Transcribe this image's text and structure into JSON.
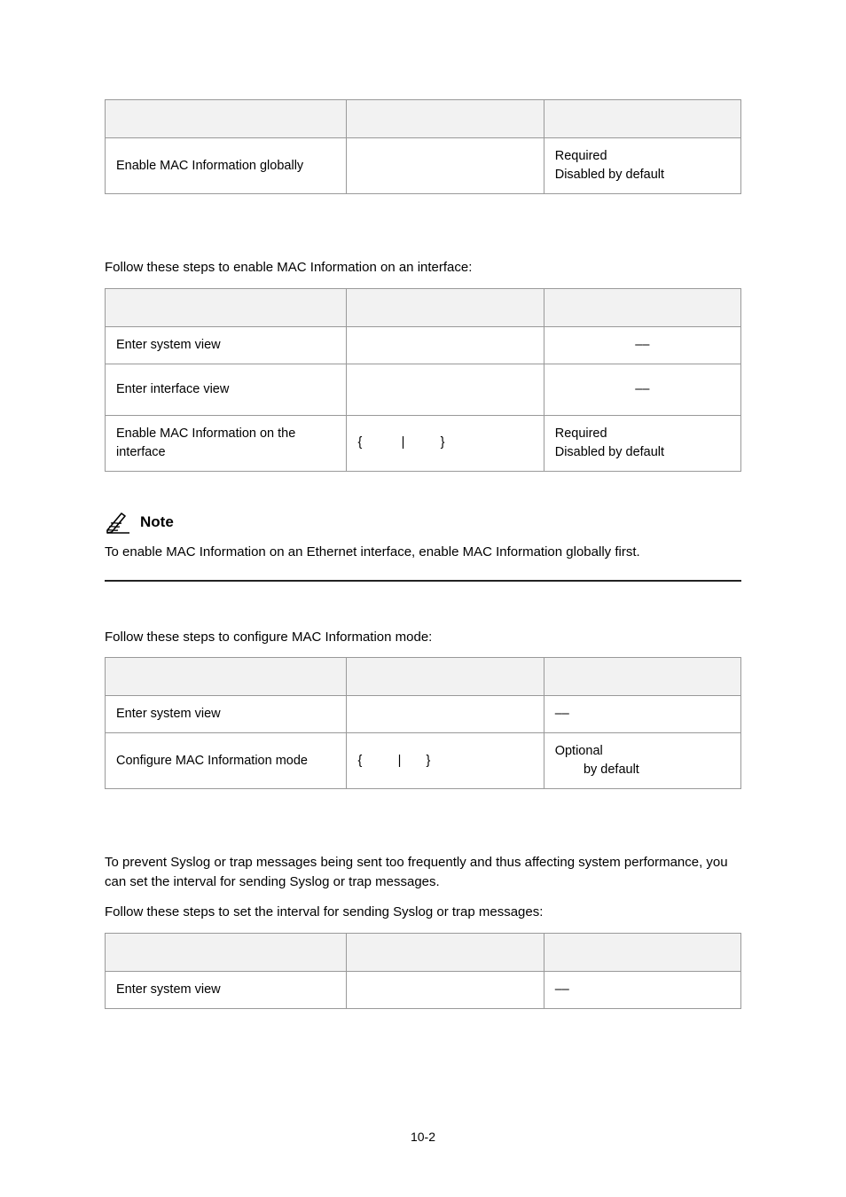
{
  "t1": {
    "r2c1": "Enable MAC Information globally",
    "r2c3a": "Required",
    "r2c3b": "Disabled by default"
  },
  "s2": {
    "lead": "Follow these steps to enable MAC Information on an interface:",
    "r1c1": "Enter system view",
    "r1c3": "––",
    "r2c1": "Enter interface view",
    "r2c3": "––",
    "r3c1": "Enable MAC Information on the interface",
    "r3c2": "{           |          }",
    "r3c3a": "Required",
    "r3c3b": "Disabled by default"
  },
  "note": {
    "label": "Note",
    "text": "To enable MAC Information on an Ethernet interface, enable MAC Information globally first."
  },
  "s3": {
    "lead": "Follow these steps to configure MAC Information mode:",
    "r1c1": "Enter system view",
    "r1c3": "––",
    "r2c1": "Configure MAC Information mode",
    "r2c2": "{          |       }",
    "r2c3a": "Optional",
    "r2c3b": "        by default"
  },
  "s4": {
    "p1": "To prevent Syslog or trap messages being sent too frequently and thus affecting system performance, you can set the interval for sending Syslog or trap messages.",
    "p2": "Follow these steps to set the interval for sending Syslog or trap messages:",
    "r1c1": "Enter system view",
    "r1c3": "––"
  },
  "footer": "10-2"
}
